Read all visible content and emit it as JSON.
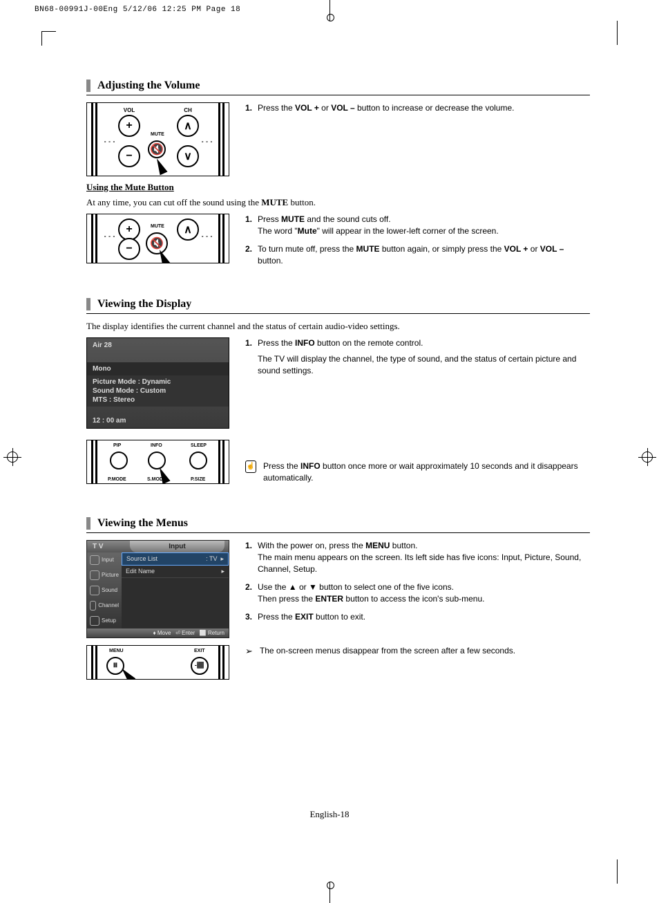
{
  "print_header": "BN68-00991J-00Eng  5/12/06  12:25 PM  Page 18",
  "section1": {
    "title": "Adjusting the Volume",
    "remote_labels": {
      "vol": "VOL",
      "ch": "CH",
      "mute": "MUTE"
    },
    "step1_pre": "Press the ",
    "step1_b1": "VOL +",
    "step1_mid": " or ",
    "step1_b2": "VOL –",
    "step1_post": " button to increase or decrease the volume.",
    "sub_heading": "Using the Mute Button",
    "sub_para_pre": "At any time, you can cut off the sound using the ",
    "sub_para_b": "MUTE",
    "sub_para_post": " button.",
    "mute1_a": "Press ",
    "mute1_b": "MUTE",
    "mute1_c": " and the sound cuts off.",
    "mute1_d": "The word \"",
    "mute1_e": "Mute",
    "mute1_f": "\" will appear in the lower-left corner of the screen.",
    "mute2_a": "To turn mute off, press the ",
    "mute2_b": "MUTE",
    "mute2_c": " button again, or simply press the ",
    "mute2_d": "VOL +",
    "mute2_e": " or ",
    "mute2_f": "VOL –",
    "mute2_g": " button."
  },
  "section2": {
    "title": "Viewing the Display",
    "intro": "The display identifies the current channel and the status of certain audio-video settings.",
    "osd": {
      "channel": "Air 28",
      "sound": "Mono",
      "picture_mode": "Picture Mode : Dynamic",
      "sound_mode": "Sound Mode : Custom",
      "mts": "MTS : Stereo",
      "time": "12 : 00 am"
    },
    "remote_labels": {
      "pip": "PIP",
      "info": "INFO",
      "sleep": "SLEEP",
      "pmode": "P.MODE",
      "smode": "S.MODE",
      "psize": "P.SIZE"
    },
    "step1_a": "Press the ",
    "step1_b": "INFO",
    "step1_c": " button on the remote control.",
    "step1_d": "The TV will display the channel, the type of sound, and the status of certain picture and sound settings.",
    "note_a": "Press the ",
    "note_b": "INFO",
    "note_c": " button once more or wait approximately 10 seconds and it disappears automatically."
  },
  "section3": {
    "title": "Viewing the Menus",
    "menu_osd": {
      "tv": "T V",
      "input": "Input",
      "side": [
        "Input",
        "Picture",
        "Sound",
        "Channel",
        "Setup"
      ],
      "source_list": "Source List",
      "source_val": ": TV",
      "edit_name": "Edit Name",
      "footer_move": "Move",
      "footer_enter": "Enter",
      "footer_return": "Return"
    },
    "remote_labels": {
      "menu": "MENU",
      "exit": "EXIT"
    },
    "step1_a": "With the power on, press the ",
    "step1_b": "MENU",
    "step1_c": " button.",
    "step1_d": "The main menu appears on the screen. Its left side has five icons: Input, Picture, Sound, Channel, Setup.",
    "step2_a": "Use the ",
    "step2_b": " or ",
    "step2_c": " button to select one of the five icons.",
    "step2_d": "Then press the ",
    "step2_e": "ENTER",
    "step2_f": " button to access the icon's sub-menu.",
    "step3_a": "Press the ",
    "step3_b": "EXIT",
    "step3_c": " button to exit.",
    "note": "The on-screen menus disappear from the screen after a few seconds."
  },
  "footer": "English-18"
}
